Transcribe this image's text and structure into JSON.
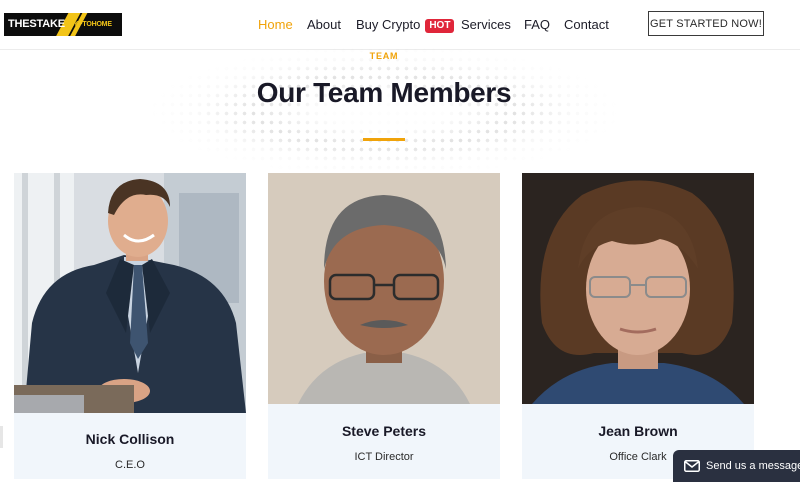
{
  "header": {
    "logo_text": "THESTAKE",
    "logo_subtext": "CRYPTOHOME",
    "nav": [
      {
        "label": "Home",
        "active": true
      },
      {
        "label": "About"
      },
      {
        "label": "Buy Crypto",
        "badge": "HOT"
      },
      {
        "label": "Services"
      },
      {
        "label": "FAQ"
      },
      {
        "label": "Contact"
      }
    ],
    "cta_label": "GET STARTED NOW!"
  },
  "section": {
    "eyebrow": "TEAM",
    "title": "Our Team Members"
  },
  "team": [
    {
      "name": "Nick Collison",
      "role": "C.E.O"
    },
    {
      "name": "Steve Peters",
      "role": "ICT Director"
    },
    {
      "name": "Jean Brown",
      "role": "Office Clark"
    }
  ],
  "chat": {
    "label": "Send us a message",
    "icon": "envelope-icon"
  },
  "colors": {
    "accent": "#f0a30a",
    "hot_badge": "#e0263a",
    "card_bg": "#f1f6fb",
    "chat_bg": "#2a3040"
  }
}
